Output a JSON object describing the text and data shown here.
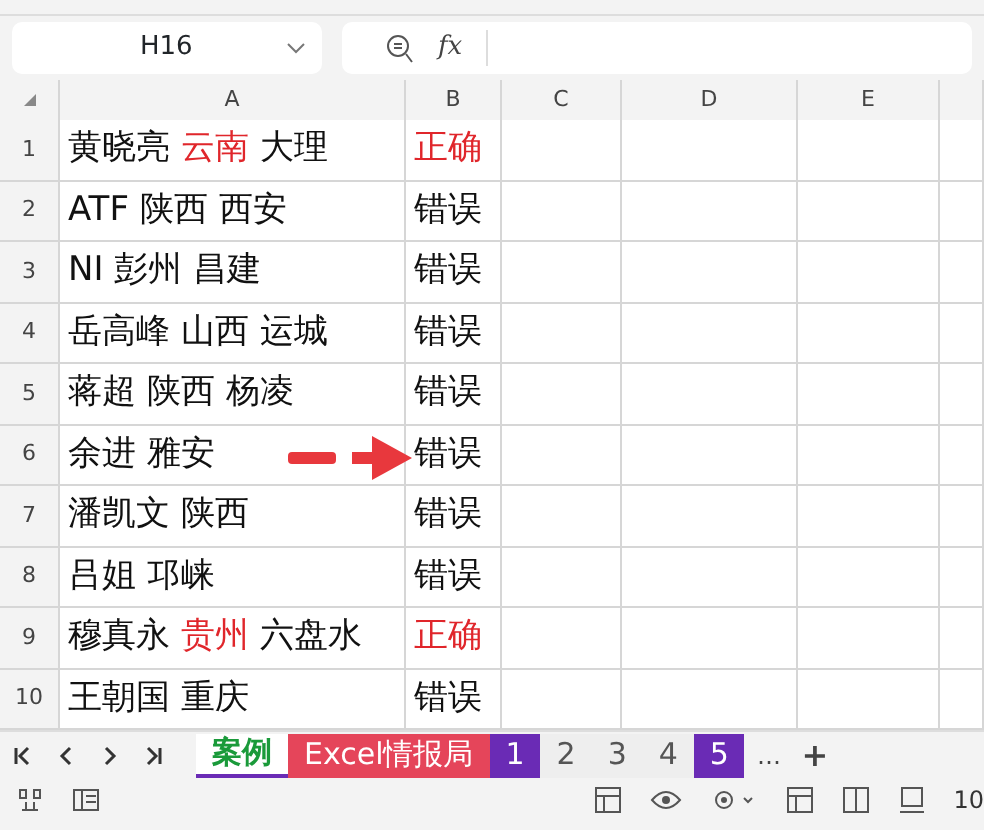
{
  "name_box": {
    "value": "H16"
  },
  "formula_bar": {
    "function_label": "fx"
  },
  "columns": [
    "A",
    "B",
    "C",
    "D",
    "E"
  ],
  "rows": [
    {
      "number": "1",
      "a": [
        {
          "text": "黄晓亮 "
        },
        {
          "text": "云南",
          "color": "#e0262b"
        },
        {
          "text": " 大理"
        }
      ],
      "b": {
        "text": "正确",
        "color": "#e0262b"
      }
    },
    {
      "number": "2",
      "a": [
        {
          "text": "ATF 陕西 西安"
        }
      ],
      "b": {
        "text": "错误",
        "color": "#111111"
      }
    },
    {
      "number": "3",
      "a": [
        {
          "text": "NI 彭州 昌建"
        }
      ],
      "b": {
        "text": "错误",
        "color": "#111111"
      }
    },
    {
      "number": "4",
      "a": [
        {
          "text": "岳高峰 山西 运城"
        }
      ],
      "b": {
        "text": "错误",
        "color": "#111111"
      }
    },
    {
      "number": "5",
      "a": [
        {
          "text": "蒋超 陕西 杨凌"
        }
      ],
      "b": {
        "text": "错误",
        "color": "#111111"
      }
    },
    {
      "number": "6",
      "a": [
        {
          "text": "余进 雅安"
        }
      ],
      "b": {
        "text": "错误",
        "color": "#111111"
      },
      "arrow": true
    },
    {
      "number": "7",
      "a": [
        {
          "text": "潘凯文 陕西"
        }
      ],
      "b": {
        "text": "错误",
        "color": "#111111"
      }
    },
    {
      "number": "8",
      "a": [
        {
          "text": "吕姐 邛崃"
        }
      ],
      "b": {
        "text": "错误",
        "color": "#111111"
      }
    },
    {
      "number": "9",
      "a": [
        {
          "text": "穆真永 "
        },
        {
          "text": "贵州",
          "color": "#e0262b"
        },
        {
          "text": " 六盘水"
        }
      ],
      "b": {
        "text": "正确",
        "color": "#e0262b"
      }
    },
    {
      "number": "10",
      "a": [
        {
          "text": "王朝国 重庆"
        }
      ],
      "b": {
        "text": "错误",
        "color": "#111111"
      }
    }
  ],
  "sheet_tabs": [
    {
      "label": "案例",
      "selected": true,
      "color": "#ffffff"
    },
    {
      "label": "Excel情报局",
      "selected": false,
      "color": "#e5455a"
    },
    {
      "label": "1",
      "selected": false,
      "color": "#6a2bb5"
    },
    {
      "label": "2",
      "selected": false,
      "color": "#eeeeee"
    },
    {
      "label": "3",
      "selected": false,
      "color": "#eeeeee"
    },
    {
      "label": "4",
      "selected": false,
      "color": "#eeeeee"
    },
    {
      "label": "5",
      "selected": false,
      "color": "#6a2bb5"
    }
  ],
  "more_tabs": "…",
  "add_tab": "+",
  "status_bar": {
    "zoom": "10"
  }
}
